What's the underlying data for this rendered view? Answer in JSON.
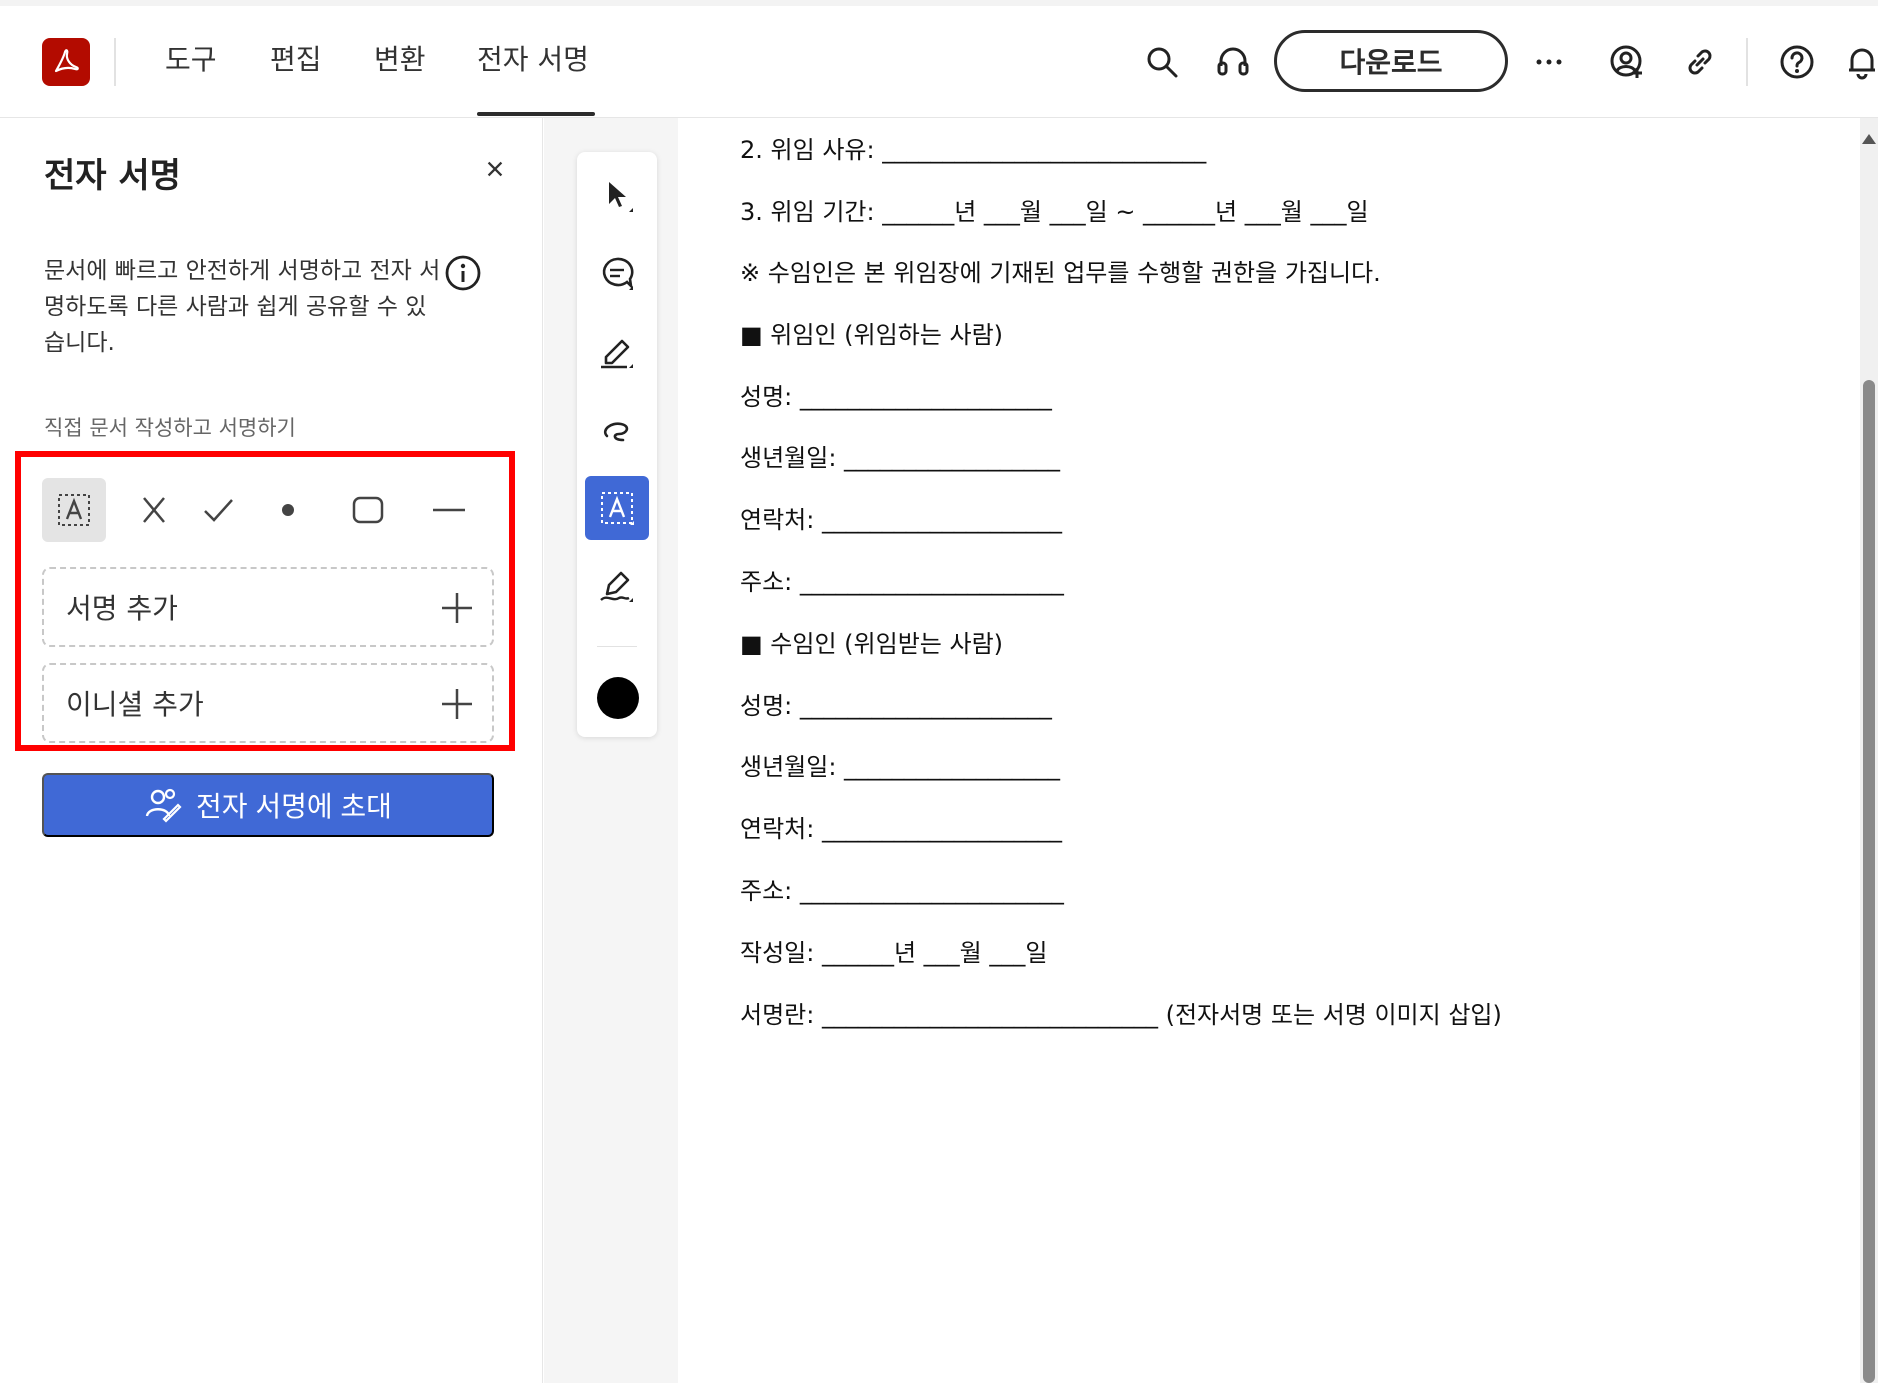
{
  "header": {
    "nav": [
      "도구",
      "편집",
      "변환",
      "전자 서명"
    ],
    "active_tab": "전자 서명",
    "download_label": "다운로드",
    "icons": [
      "search-icon",
      "headset-icon",
      "more-icon",
      "share-user-icon",
      "link-icon",
      "help-icon",
      "bell-icon"
    ]
  },
  "panel": {
    "title": "전자 서명",
    "description": "문서에 빠르고 안전하게 서명하고 전자 서명하도록 다른 사람과 쉽게 공유할 수 있습니다.",
    "section_label": "직접 문서 작성하고 서명하기",
    "tools": [
      "text-field-icon",
      "cross-icon",
      "checkmark-icon",
      "dot-icon",
      "rectangle-icon",
      "line-icon"
    ],
    "add_signature": "서명 추가",
    "add_initials": "이니셜 추가",
    "invite_button": "전자 서명에 초대"
  },
  "vertical_toolbar": {
    "tools": [
      "select-pointer-icon",
      "comment-icon",
      "highlighter-icon",
      "draw-freehand-icon",
      "text-field-icon",
      "sign-pen-icon"
    ],
    "active_tool": "text-field-icon",
    "current_color": "#000000"
  },
  "document": {
    "lines": [
      "2. 위임 사유: ___________________________",
      "3. 위임 기간: ______년 ___월 ___일 ~ ______년 ___월 ___일",
      "※ 수임인은 본 위임장에 기재된 업무를 수행할 권한을 가집니다.",
      "■ 위임인 (위임하는 사람)",
      "성명: _____________________",
      "생년월일: __________________",
      "연락처: ____________________",
      "주소: ______________________",
      "■ 수임인 (위임받는 사람)",
      "성명: _____________________",
      "생년월일: __________________",
      "연락처: ____________________",
      "주소: ______________________",
      "작성일: ______년 ___월 ___일",
      "서명란: ____________________________ (전자서명 또는 서명 이미지 삽입)"
    ]
  },
  "colors": {
    "accent": "#4069d6",
    "logo": "#b30b00",
    "highlight": "#ff0000"
  }
}
